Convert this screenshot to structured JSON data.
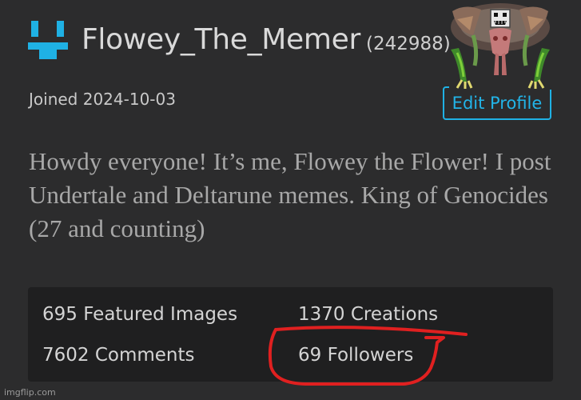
{
  "profile": {
    "username": "Flowey_The_Memer",
    "points": "(242988)",
    "joined": "Joined 2024-10-03",
    "edit_button": "Edit Profile",
    "bio": "Howdy everyone! It’s me, Flowey the Flower! I post Undertale and Deltarune memes. King of Genocides (27 and counting)"
  },
  "stats": {
    "featured_images": "695 Featured Images",
    "creations": "1370 Creations",
    "comments": "7602 Comments",
    "followers": "69 Followers"
  },
  "watermark": "imgflip.com",
  "colors": {
    "background": "#2c2c2d",
    "stats_panel": "#1f1f20",
    "accent": "#1fb1e4",
    "annotation": "#e02020"
  },
  "icons": {
    "logo": "imgflip-logo-icon",
    "avatar": "omega-flowey-avatar"
  }
}
